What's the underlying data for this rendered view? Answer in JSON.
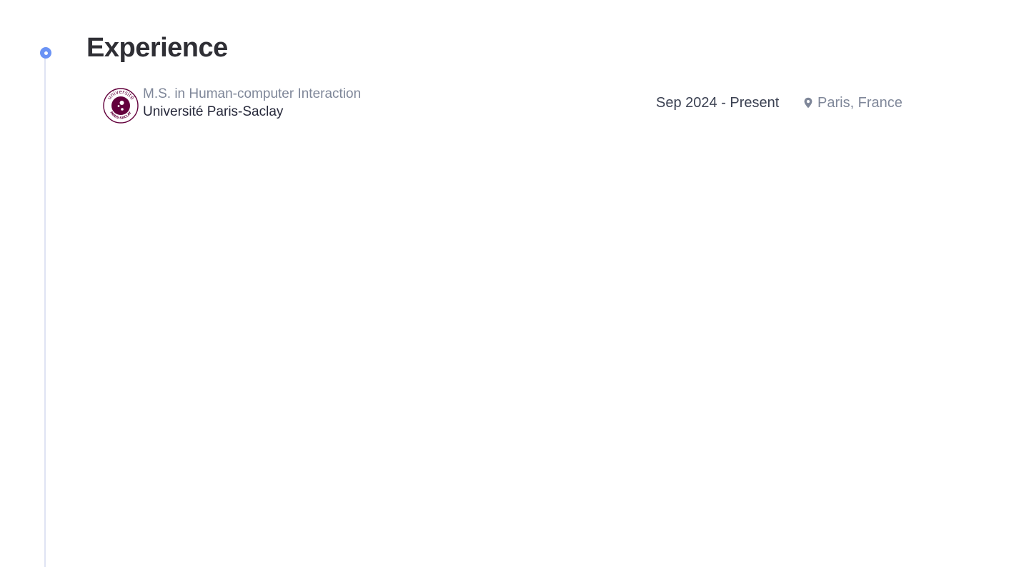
{
  "section": {
    "title": "Experience",
    "accent_color": "#6b93f5"
  },
  "entries": [
    {
      "degree": "M.S. in Human-computer Interaction",
      "institution": "Université Paris-Saclay",
      "dates": "Sep 2024 - Present",
      "location": "Paris, France",
      "logo": {
        "icon": "university-logo-icon",
        "ring_top_text": "université",
        "ring_bottom_text": "PARIS-SACLAY",
        "brand_color": "#63003c"
      },
      "location_icon": "map-pin-icon"
    }
  ]
}
